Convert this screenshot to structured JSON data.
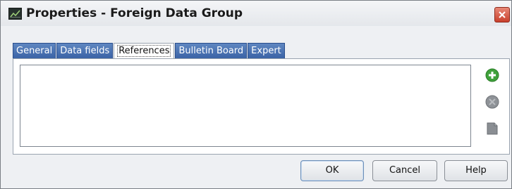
{
  "window": {
    "title": "Properties - Foreign Data Group",
    "icon": "dialog-app-icon"
  },
  "tabs": [
    {
      "label": "General",
      "active": false
    },
    {
      "label": "Data fields",
      "active": false
    },
    {
      "label": "References",
      "active": true
    },
    {
      "label": "Bulletin Board",
      "active": false
    },
    {
      "label": "Expert",
      "active": false
    }
  ],
  "references": {
    "items": [],
    "actions": [
      {
        "icon": "add-icon",
        "enabled": true
      },
      {
        "icon": "remove-icon",
        "enabled": false
      },
      {
        "icon": "edit-icon",
        "enabled": false
      }
    ]
  },
  "buttons": {
    "ok": "OK",
    "cancel": "Cancel",
    "help": "Help"
  },
  "colors": {
    "tab_blue": "#3b63a6",
    "close_red": "#c9402c",
    "add_green": "#3fa13b"
  }
}
